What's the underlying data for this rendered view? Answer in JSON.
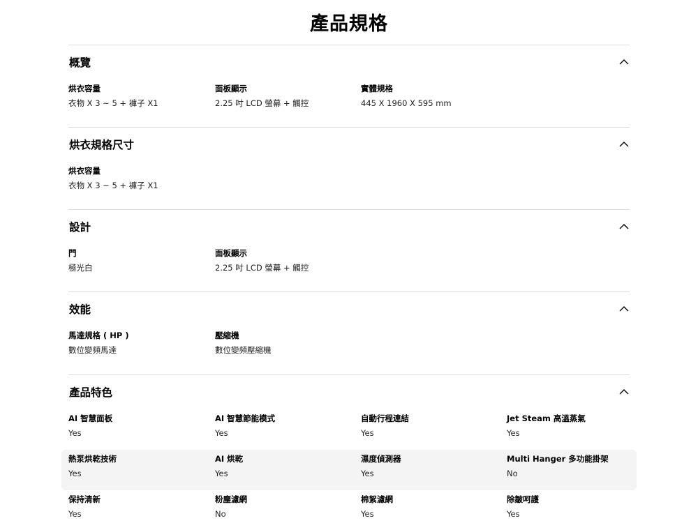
{
  "page_title": "產品規格",
  "sections": [
    {
      "title": "概覽",
      "rows": [
        [
          {
            "label": "烘衣容量",
            "value": "衣物 X 3 ~ 5 + 褲子 X1"
          },
          {
            "label": "面板顯示",
            "value": "2.25 吋 LCD 螢幕 + 觸控"
          },
          {
            "label": "實體規格",
            "value": "445 X 1960 X 595 mm"
          }
        ]
      ]
    },
    {
      "title": "烘衣規格尺寸",
      "rows": [
        [
          {
            "label": "烘衣容量",
            "value": "衣物 X 3 ~ 5 + 褲子 X1"
          }
        ]
      ]
    },
    {
      "title": "設計",
      "rows": [
        [
          {
            "label": "門",
            "value": "極光白"
          },
          {
            "label": "面板顯示",
            "value": "2.25 吋 LCD 螢幕 + 觸控"
          }
        ]
      ]
    },
    {
      "title": "效能",
      "rows": [
        [
          {
            "label": "馬達規格 ( HP )",
            "value": "數位變頻馬達"
          },
          {
            "label": "壓縮機",
            "value": "數位變頻壓縮機"
          }
        ]
      ]
    },
    {
      "title": "產品特色",
      "rows": [
        [
          {
            "label": "AI 智慧面板",
            "value": "Yes"
          },
          {
            "label": "AI 智慧節能模式",
            "value": "Yes"
          },
          {
            "label": "自動行程連結",
            "value": "Yes"
          },
          {
            "label": "Jet Steam 高溫蒸氣",
            "value": "Yes"
          }
        ],
        [
          {
            "label": "熱泵烘乾技術",
            "value": "Yes"
          },
          {
            "label": "AI 烘乾",
            "value": "Yes"
          },
          {
            "label": "濕度偵測器",
            "value": "Yes"
          },
          {
            "label": "Multi Hanger 多功能掛架",
            "value": "No"
          }
        ],
        [
          {
            "label": "保持清新",
            "value": "Yes"
          },
          {
            "label": "粉塵濾網",
            "value": "No"
          },
          {
            "label": "棉絮濾網",
            "value": "Yes"
          },
          {
            "label": "除皺呵護",
            "value": "Yes"
          }
        ]
      ]
    }
  ],
  "icons": {
    "section_toggle": "chevron-up-icon"
  },
  "colors": {
    "divider": "#dcdcdc",
    "highlight_row": "#f4f4f4",
    "text": "#000000"
  }
}
